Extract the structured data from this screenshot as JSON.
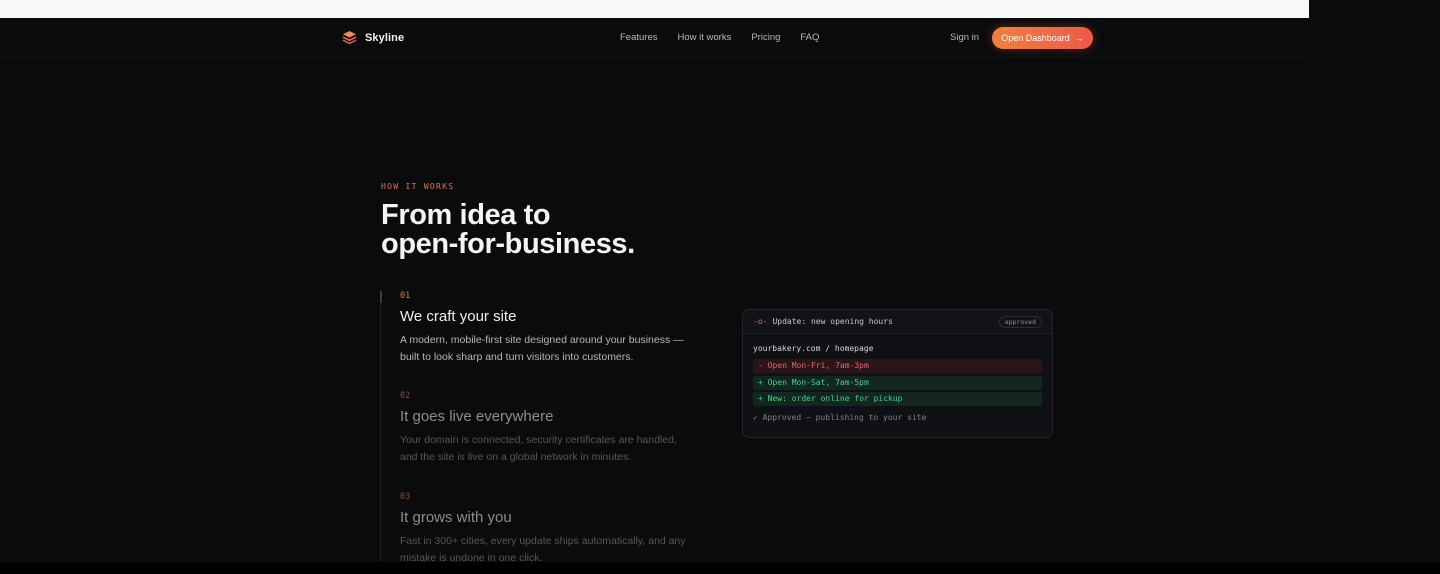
{
  "nav": {
    "brand": "Skyline",
    "links": [
      "Features",
      "How it works",
      "Pricing",
      "FAQ"
    ],
    "sign_in": "Sign in",
    "cta": "Open Dashboard",
    "cta_arrow": "→"
  },
  "hero": {
    "eyebrow": "HOW IT WORKS",
    "headline_line1": "From idea to",
    "headline_line2": "open-for-business."
  },
  "steps": [
    {
      "num": "01",
      "title": "We craft your site",
      "desc": "A modern, mobile-first site designed around your business — built to look sharp and turn visitors into customers."
    },
    {
      "num": "02",
      "title": "It goes live everywhere",
      "desc": "Your domain is connected, security certificates are handled, and the site is live on a global network in minutes."
    },
    {
      "num": "03",
      "title": "It grows with you",
      "desc": "Fast in 300+ cities, every update ships automatically, and any mistake is undone in one click."
    }
  ],
  "card": {
    "icon": "-o-",
    "title": "Update: new opening hours",
    "badge": "approved",
    "path": "yourbakery.com / homepage",
    "diff": [
      {
        "type": "rem",
        "text": "- Open Mon-Fri, 7am-3pm"
      },
      {
        "type": "add",
        "text": "+ Open Mon-Sat, 7am-5pm"
      },
      {
        "type": "add",
        "text": "+ New: order online for pickup"
      }
    ],
    "footer": "✓ Approved — publishing to your site"
  },
  "colors": {
    "accent": "#e2784a",
    "cta_start": "#f17f3f",
    "cta_end": "#ee5a48",
    "background": "#0a0b0d"
  }
}
